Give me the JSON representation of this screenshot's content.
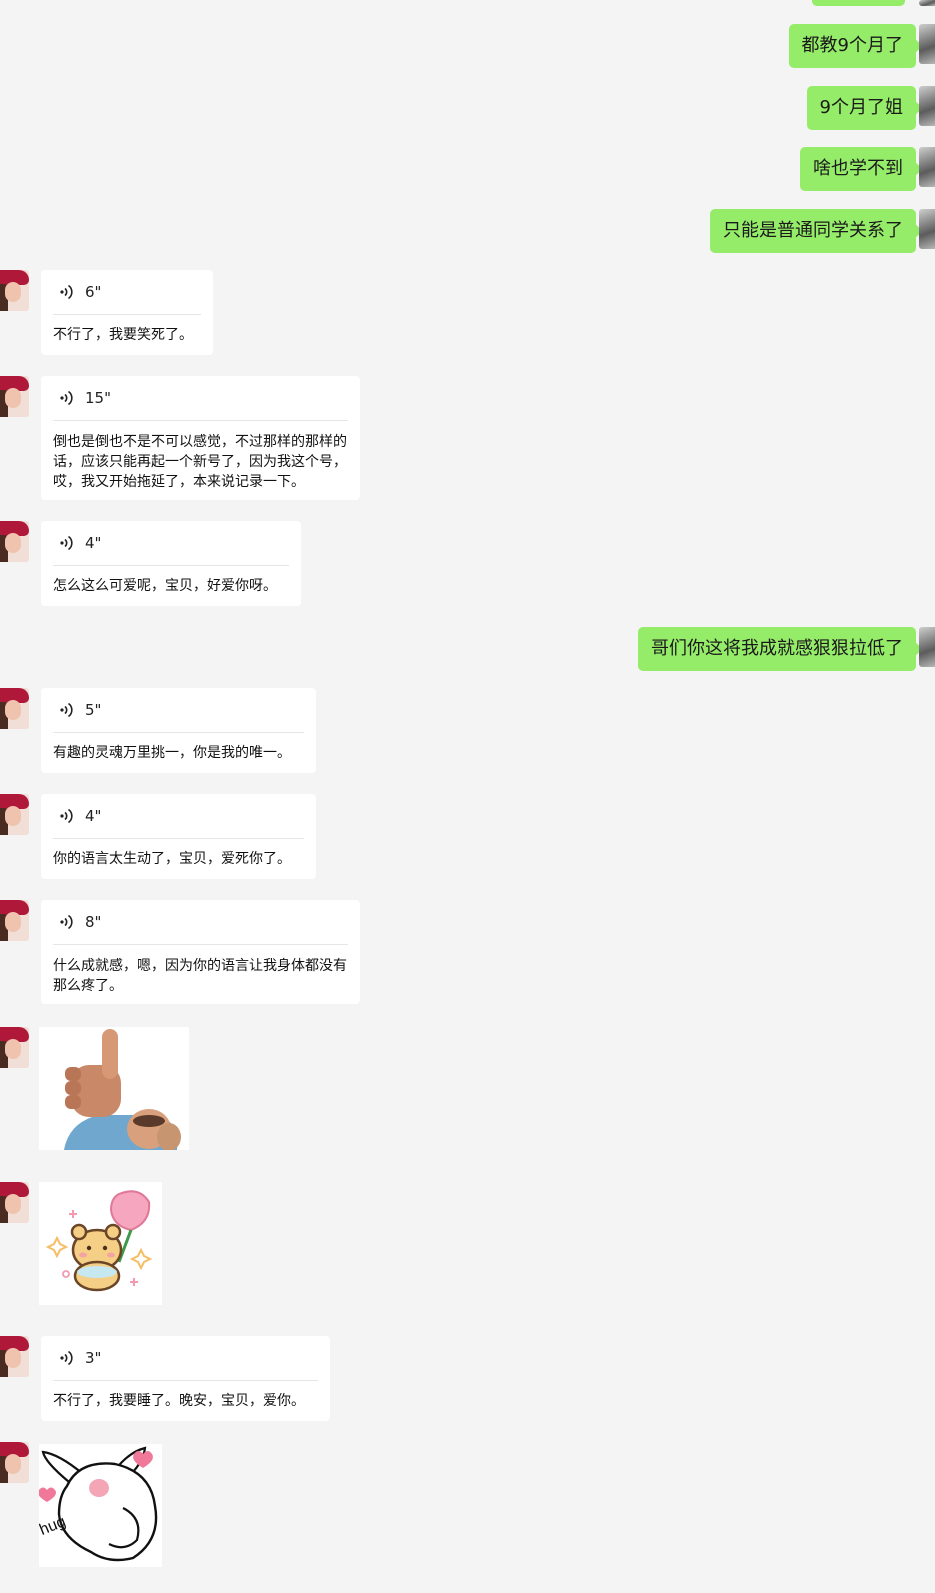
{
  "sent_messages": [
    {
      "text": "都教9个月了"
    },
    {
      "text": "9个月了姐"
    },
    {
      "text": "啥也学不到"
    },
    {
      "text": "只能是普通同学关系了"
    },
    {
      "text": "哥们你这将我成就感狠狠拉低了"
    }
  ],
  "voice_messages": [
    {
      "duration": "6\"",
      "text": "不行了，我要笑死了。"
    },
    {
      "duration": "15\"",
      "text": "倒也是倒也不是不可以感觉，不过那样的那样的话，应该只能再起一个新号了，因为我这个号，哎，我又开始拖延了，本来说记录一下。"
    },
    {
      "duration": "4\"",
      "text": "怎么这么可爱呢，宝贝，好爱你呀。"
    },
    {
      "duration": "5\"",
      "text": "有趣的灵魂万里挑一，你是我的唯一。"
    },
    {
      "duration": "4\"",
      "text": "你的语言太生动了，宝贝，爱死你了。"
    },
    {
      "duration": "8\"",
      "text": "什么成就感，嗯，因为你的语言让我身体都没有那么疼了。"
    },
    {
      "duration": "3\"",
      "text": "不行了，我要睡了。晚安，宝贝，爱你。"
    }
  ],
  "stickers": [
    {
      "icon": "thumbs-up-sticker"
    },
    {
      "icon": "bear-with-flower-sticker"
    },
    {
      "icon": "bunny-hug-sticker",
      "caption": "hug"
    }
  ],
  "colors": {
    "background": "#f4f4f4",
    "sent_bubble": "#95ec69",
    "received_bubble": "#ffffff"
  }
}
